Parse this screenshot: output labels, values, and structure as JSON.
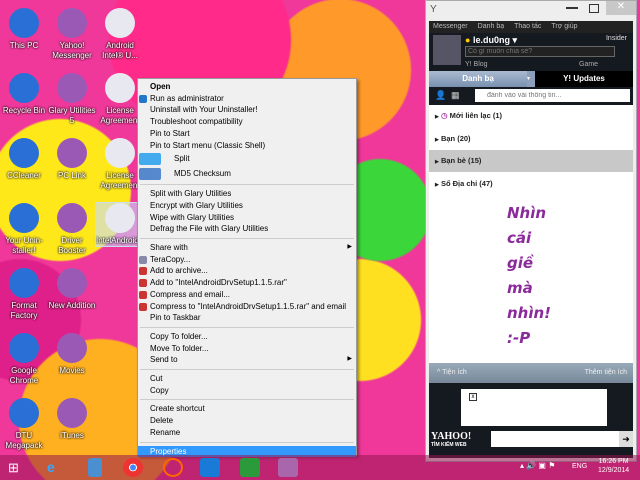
{
  "desktop": {
    "icons": [
      {
        "label": "This PC",
        "col": 0,
        "row": 0
      },
      {
        "label": "Recycle Bin",
        "col": 0,
        "row": 1
      },
      {
        "label": "CCleaner",
        "col": 0,
        "row": 2
      },
      {
        "label": "Your Unin-staller!",
        "col": 0,
        "row": 3
      },
      {
        "label": "Format Factory",
        "col": 0,
        "row": 4
      },
      {
        "label": "Google Chrome",
        "col": 0,
        "row": 5
      },
      {
        "label": "DTU Megapack",
        "col": 0,
        "row": 6
      },
      {
        "label": "Yahoo! Messenger",
        "col": 1,
        "row": 0
      },
      {
        "label": "Glary Utilities 5",
        "col": 1,
        "row": 1
      },
      {
        "label": "PC Link",
        "col": 1,
        "row": 2
      },
      {
        "label": "Driver Booster",
        "col": 1,
        "row": 3
      },
      {
        "label": "New Addition",
        "col": 1,
        "row": 4
      },
      {
        "label": "Movies",
        "col": 1,
        "row": 5
      },
      {
        "label": "iTunes",
        "col": 1,
        "row": 6
      },
      {
        "label": "Android Intel® U...",
        "col": 2,
        "row": 0
      },
      {
        "label": "License Agreement",
        "col": 2,
        "row": 1
      },
      {
        "label": "License Agreement",
        "col": 2,
        "row": 2
      },
      {
        "label": "IntelAndroidDrvSetup1.1.5.exe",
        "col": 2,
        "row": 3,
        "selected": true
      }
    ]
  },
  "context_menu": {
    "items": [
      {
        "label": "Open",
        "bold": true
      },
      {
        "label": "Run as administrator",
        "icon": "shield-icon"
      },
      {
        "label": "Uninstall with Your Uninstaller!"
      },
      {
        "label": "Troubleshoot compatibility"
      },
      {
        "label": "Pin to Start"
      },
      {
        "label": "Pin to Start menu (Classic Shell)"
      },
      {
        "label": "Split",
        "icon": "split-icon"
      },
      {
        "label": "MD5 Checksum",
        "icon": "md5-icon"
      },
      {
        "sep": true
      },
      {
        "label": "Split with Glary Utilities"
      },
      {
        "label": "Encrypt with Glary Utilities"
      },
      {
        "label": "Wipe with Glary Utilities"
      },
      {
        "label": "Defrag the File with Glary Utilities"
      },
      {
        "sep": true
      },
      {
        "label": "Share with",
        "submenu": true
      },
      {
        "label": "TeraCopy...",
        "icon": "teracopy-icon"
      },
      {
        "label": "Add to archive...",
        "icon": "winrar-icon"
      },
      {
        "label": "Add to \"IntelAndroidDrvSetup1.1.5.rar\"",
        "icon": "winrar-icon"
      },
      {
        "label": "Compress and email...",
        "icon": "winrar-icon"
      },
      {
        "label": "Compress to \"IntelAndroidDrvSetup1.1.5.rar\" and email",
        "icon": "winrar-icon"
      },
      {
        "label": "Pin to Taskbar"
      },
      {
        "sep": true
      },
      {
        "label": "Copy To folder..."
      },
      {
        "label": "Move To folder..."
      },
      {
        "label": "Send to",
        "submenu": true
      },
      {
        "sep": true
      },
      {
        "label": "Cut"
      },
      {
        "label": "Copy"
      },
      {
        "sep": true
      },
      {
        "label": "Create shortcut"
      },
      {
        "label": "Delete"
      },
      {
        "label": "Rename"
      },
      {
        "sep": true
      },
      {
        "label": "Properties",
        "highlighted": true
      }
    ]
  },
  "messenger": {
    "menu": [
      "Messenger",
      "Danh bạ",
      "Thao tác",
      "Trợ giúp"
    ],
    "username": "le.du0ng",
    "status_placeholder": "Có gì muốn chia sẻ?",
    "insider": "Insider",
    "blog": "Y! Blog",
    "game": "Game",
    "tabs": [
      "Danh bạ",
      "Y! Updates"
    ],
    "search_placeholder": "đánh vào vài thông tin...",
    "groups": [
      "Mới liên lạc (1)",
      "Bạn (20)",
      "Bạn bè (15)",
      "Sổ Địa chỉ (47)"
    ],
    "selected_group": 2,
    "message_lines": [
      "Nhìn",
      "cái",
      "giề",
      "mà",
      "nhìn!",
      ":-P"
    ],
    "footer_left": "Tiện ích",
    "footer_right": "Thêm tiện ích",
    "yahoo_logo": "YAHOO!",
    "search_web": "TÌM KIẾM WEB",
    "accent": "#8b2a9b"
  },
  "taskbar": {
    "language": "ENG",
    "time": "16:26 PM",
    "date": "12/9/2014"
  }
}
